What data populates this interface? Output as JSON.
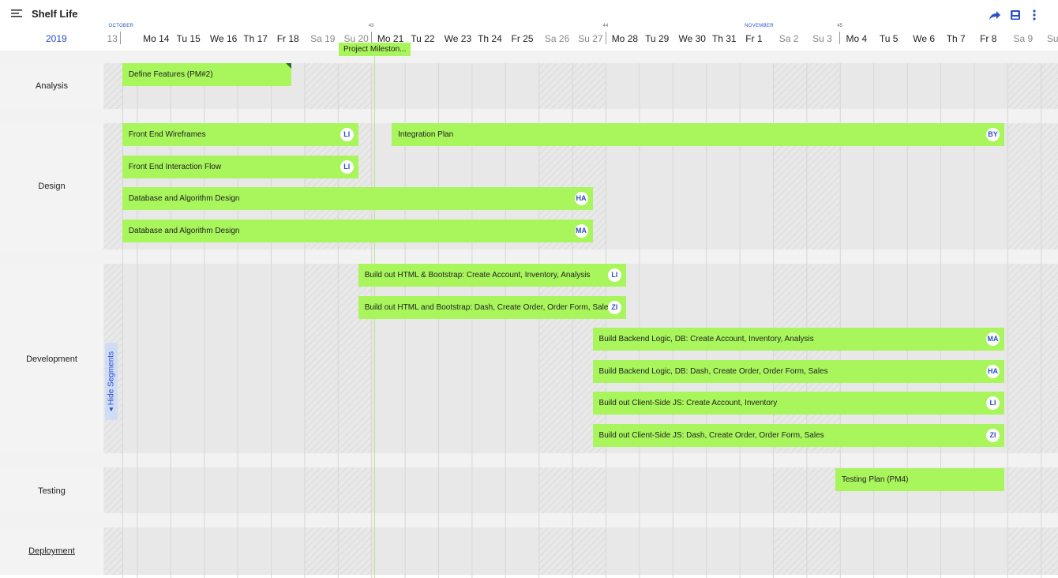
{
  "app": {
    "title": "Shelf Life"
  },
  "icons": {
    "menu": "menu-lines-icon",
    "share": "share-arrow-icon",
    "save": "save-icon",
    "more": "more-vertical-icon"
  },
  "colors": {
    "accent": "#2a4fc8",
    "bar": "#a8f55c",
    "band": "#e8e8e8"
  },
  "header": {
    "year": "2019",
    "months": [
      {
        "label": "OCTOBER",
        "day_index": 0
      },
      {
        "label": "NOVEMBER",
        "day_index": 19
      }
    ],
    "weeks": [
      {
        "label": "43",
        "day_index": 8
      },
      {
        "label": "44",
        "day_index": 15
      },
      {
        "label": "45",
        "day_index": 22
      }
    ],
    "days": [
      {
        "label": "13",
        "weekend": true
      },
      {
        "label": "Mo 14",
        "weekend": false
      },
      {
        "label": "Tu 15",
        "weekend": false
      },
      {
        "label": "We 16",
        "weekend": false
      },
      {
        "label": "Th 17",
        "weekend": false
      },
      {
        "label": "Fr 18",
        "weekend": false
      },
      {
        "label": "Sa 19",
        "weekend": true
      },
      {
        "label": "Su 20",
        "weekend": true
      },
      {
        "label": "Mo 21",
        "weekend": false
      },
      {
        "label": "Tu 22",
        "weekend": false
      },
      {
        "label": "We 23",
        "weekend": false
      },
      {
        "label": "Th 24",
        "weekend": false
      },
      {
        "label": "Fr 25",
        "weekend": false
      },
      {
        "label": "Sa 26",
        "weekend": true
      },
      {
        "label": "Su 27",
        "weekend": true
      },
      {
        "label": "Mo 28",
        "weekend": false
      },
      {
        "label": "Tu 29",
        "weekend": false
      },
      {
        "label": "We 30",
        "weekend": false
      },
      {
        "label": "Th 31",
        "weekend": false
      },
      {
        "label": "Fr 1",
        "weekend": false
      },
      {
        "label": "Sa 2",
        "weekend": true
      },
      {
        "label": "Su 3",
        "weekend": true
      },
      {
        "label": "Mo 4",
        "weekend": false
      },
      {
        "label": "Tu 5",
        "weekend": false
      },
      {
        "label": "We 6",
        "weekend": false
      },
      {
        "label": "Th 7",
        "weekend": false
      },
      {
        "label": "Fr 8",
        "weekend": false
      },
      {
        "label": "Sa 9",
        "weekend": true
      },
      {
        "label": "Su",
        "weekend": true
      }
    ]
  },
  "milestone": {
    "label": "Project Mileston..."
  },
  "segments": [
    {
      "name": "Analysis",
      "tasks": [
        {
          "label": "Define Features (PM#2)",
          "start": 0.55,
          "end": 5.6,
          "avatar": "",
          "flag": true
        }
      ]
    },
    {
      "name": "Design",
      "tasks": [
        {
          "label": "Front End Wireframes",
          "start": 0.55,
          "end": 7.6,
          "avatar": "LI"
        },
        {
          "label": "Integration Plan",
          "start": 8.6,
          "end": 26.9,
          "avatar": "BY",
          "same_row_as_previous": true
        },
        {
          "label": "Front End Interaction Flow",
          "start": 0.55,
          "end": 7.6,
          "avatar": "LI"
        },
        {
          "label": "Database and Algorithm Design",
          "start": 0.55,
          "end": 14.6,
          "avatar": "HA"
        },
        {
          "label": "Database and Algorithm Design",
          "start": 0.55,
          "end": 14.6,
          "avatar": "MA"
        }
      ]
    },
    {
      "name": "Development",
      "tasks": [
        {
          "label": "Build out HTML & Bootstrap: Create Account, Inventory, Analysis",
          "start": 7.6,
          "end": 15.6,
          "avatar": "LI"
        },
        {
          "label": "Build out HTML and Bootstrap: Dash, Create Order, Order Form, Sales",
          "start": 7.6,
          "end": 15.6,
          "avatar": "ZI"
        },
        {
          "label": "Build Backend Logic, DB: Create Account, Inventory, Analysis",
          "start": 14.6,
          "end": 26.9,
          "avatar": "MA"
        },
        {
          "label": "Build Backend Logic, DB: Dash, Create Order, Order Form, Sales",
          "start": 14.6,
          "end": 26.9,
          "avatar": "HA"
        },
        {
          "label": "Build out Client-Side JS: Create Account, Inventory",
          "start": 14.6,
          "end": 26.9,
          "avatar": "LI"
        },
        {
          "label": "Build out Client-Side JS: Dash, Create Order, Order Form, Sales",
          "start": 14.6,
          "end": 26.9,
          "avatar": "ZI"
        }
      ]
    },
    {
      "name": "Testing",
      "tasks": [
        {
          "label": "Testing Plan (PM4)",
          "start": 21.85,
          "end": 26.9,
          "avatar": ""
        }
      ]
    },
    {
      "name": "Deployment",
      "tasks": []
    }
  ],
  "hide_segments": {
    "label": "◂ Hide Segments"
  }
}
